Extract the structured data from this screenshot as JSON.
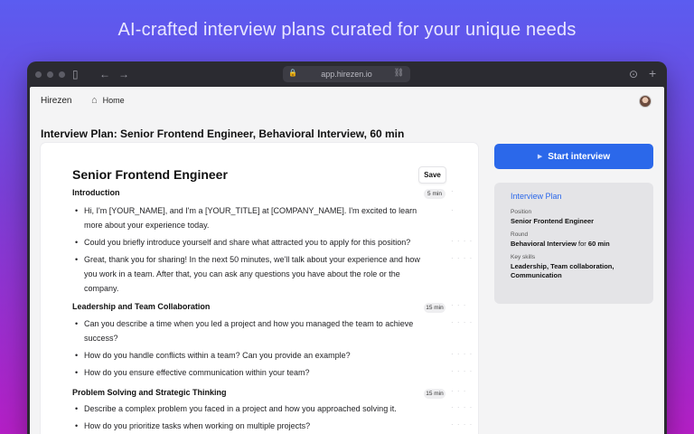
{
  "headline": "AI-crafted interview plans curated for your unique needs",
  "browser": {
    "url": "app.hirezen.io",
    "icons": {
      "sidebar": "sidebar-icon",
      "back": "arrow-left-icon",
      "forward": "arrow-right-icon",
      "lock": "lock-icon",
      "link": "link-icon",
      "download": "download-icon",
      "new_tab": "plus-icon"
    }
  },
  "nav": {
    "brand": "Hirezen",
    "home_label": "Home",
    "home_icon": "home-icon"
  },
  "page_title": "Interview Plan: Senior Frontend Engineer, Behavioral Interview, 60 min",
  "plan": {
    "heading": "Senior Frontend Engineer",
    "save_label": "Save",
    "sections": [
      {
        "title": "Introduction",
        "duration": "5 min",
        "items": [
          "Hi, I'm [YOUR_NAME], and I'm a [YOUR_TITLE] at [COMPANY_NAME]. I'm excited to learn more about your experience today.",
          "Could you briefly introduce yourself and share what attracted you to apply for this position?",
          "Great, thank you for sharing! In the next 50 minutes, we'll talk about your experience and how you work in a team. After that, you can ask any questions you have about the role or the company."
        ]
      },
      {
        "title": "Leadership and Team Collaboration",
        "duration": "15 min",
        "items": [
          "Can you describe a time when you led a project and how you managed the team to achieve success?",
          "How do you handle conflicts within a team? Can you provide an example?",
          "How do you ensure effective communication within your team?"
        ]
      },
      {
        "title": "Problem Solving and Strategic Thinking",
        "duration": "15 min",
        "items": [
          "Describe a complex problem you faced in a project and how you approached solving it.",
          "How do you prioritize tasks when working on multiple projects?"
        ]
      }
    ]
  },
  "start_button": "Start interview",
  "info": {
    "title": "Interview Plan",
    "position_label": "Position",
    "position_value": "Senior Frontend Engineer",
    "round_label": "Round",
    "round_value": "Behavioral Interview",
    "round_for": "for",
    "round_duration": "60 min",
    "skills_label": "Key skills",
    "skills_value": "Leadership, Team collaboration, Communication"
  },
  "colors": {
    "accent": "#2b68ea",
    "gradient_top": "#5b5cf0",
    "gradient_bottom": "#b51fc6"
  }
}
